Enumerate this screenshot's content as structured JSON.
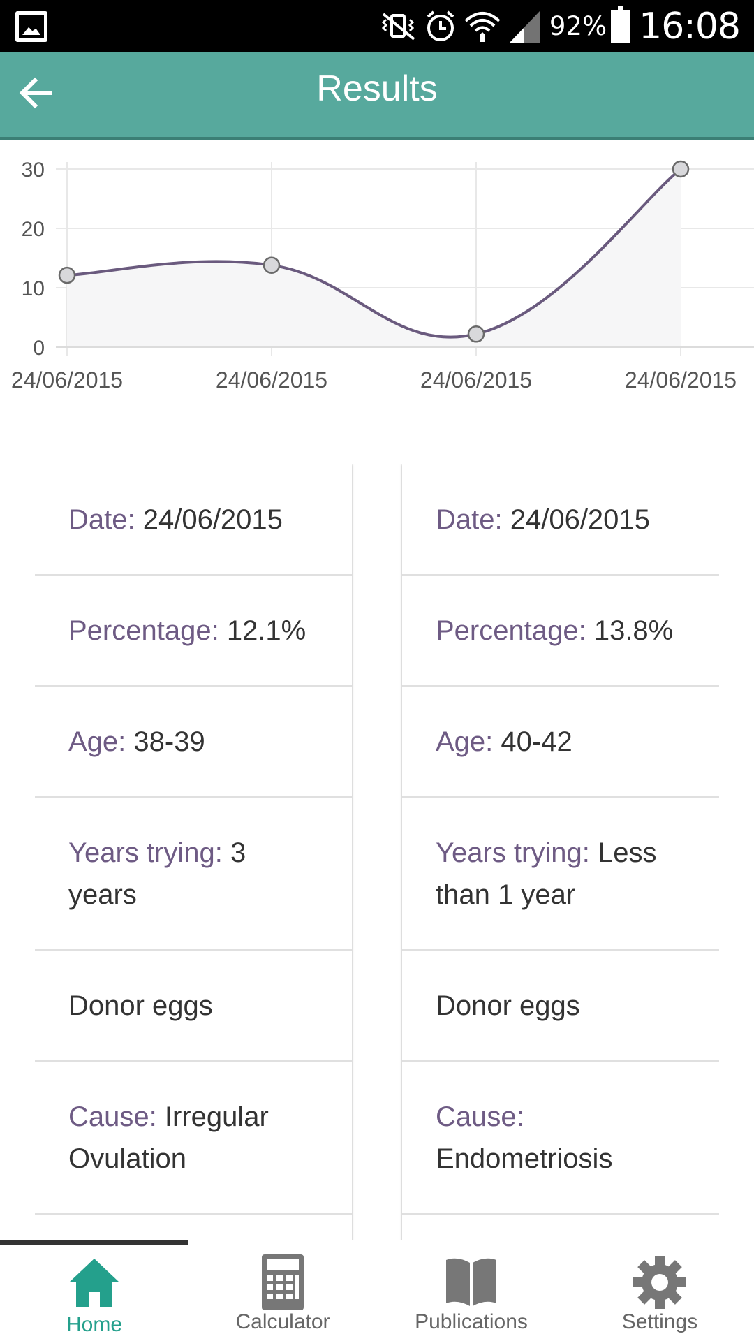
{
  "status_bar": {
    "battery": "92%",
    "time": "16:08",
    "icons": [
      "gallery-icon",
      "vibrate-icon",
      "alarm-icon",
      "wifi-icon",
      "signal-icon",
      "battery-charging-icon"
    ]
  },
  "app_bar": {
    "title": "Results",
    "back_icon": "arrow-left-icon"
  },
  "chart_data": {
    "type": "line",
    "x": [
      "24/06/2015",
      "24/06/2015",
      "24/06/2015",
      "24/06/2015"
    ],
    "series": [
      {
        "values": [
          12.1,
          13.8,
          2.2,
          30.0
        ]
      }
    ],
    "yticks": [
      "0",
      "10",
      "20",
      "30"
    ],
    "ylim": [
      0,
      30
    ],
    "grid": true,
    "colors": {
      "line": "#6a5a7e",
      "fill": "#f6f6f7",
      "point": "#d8d8db"
    }
  },
  "cards": [
    {
      "date_label": "Date: ",
      "date": "24/06/2015",
      "percentage_label": "Percentage: ",
      "percentage": "12.1%",
      "age_label": "Age: ",
      "age": "38-39",
      "years_label": "Years trying: ",
      "years": "3 years",
      "treatment": "Donor eggs",
      "cause_label": "Cause: ",
      "cause": "Irregular Ovulation"
    },
    {
      "date_label": "Date: ",
      "date": "24/06/2015",
      "percentage_label": "Percentage: ",
      "percentage": "13.8%",
      "age_label": "Age: ",
      "age": "40-42",
      "years_label": "Years trying: ",
      "years": "Less than 1 year",
      "treatment": "Donor eggs",
      "cause_label": "Cause: ",
      "cause": "Endometriosis"
    }
  ],
  "bottom_nav": [
    {
      "label": "Home",
      "icon": "home-icon",
      "active": true
    },
    {
      "label": "Calculator",
      "icon": "calculator-icon",
      "active": false
    },
    {
      "label": "Publications",
      "icon": "book-icon",
      "active": false
    },
    {
      "label": "Settings",
      "icon": "gear-icon",
      "active": false
    }
  ],
  "colors": {
    "primary": "#57a99d",
    "label": "#6e5b84",
    "active_nav": "#24a08c"
  }
}
